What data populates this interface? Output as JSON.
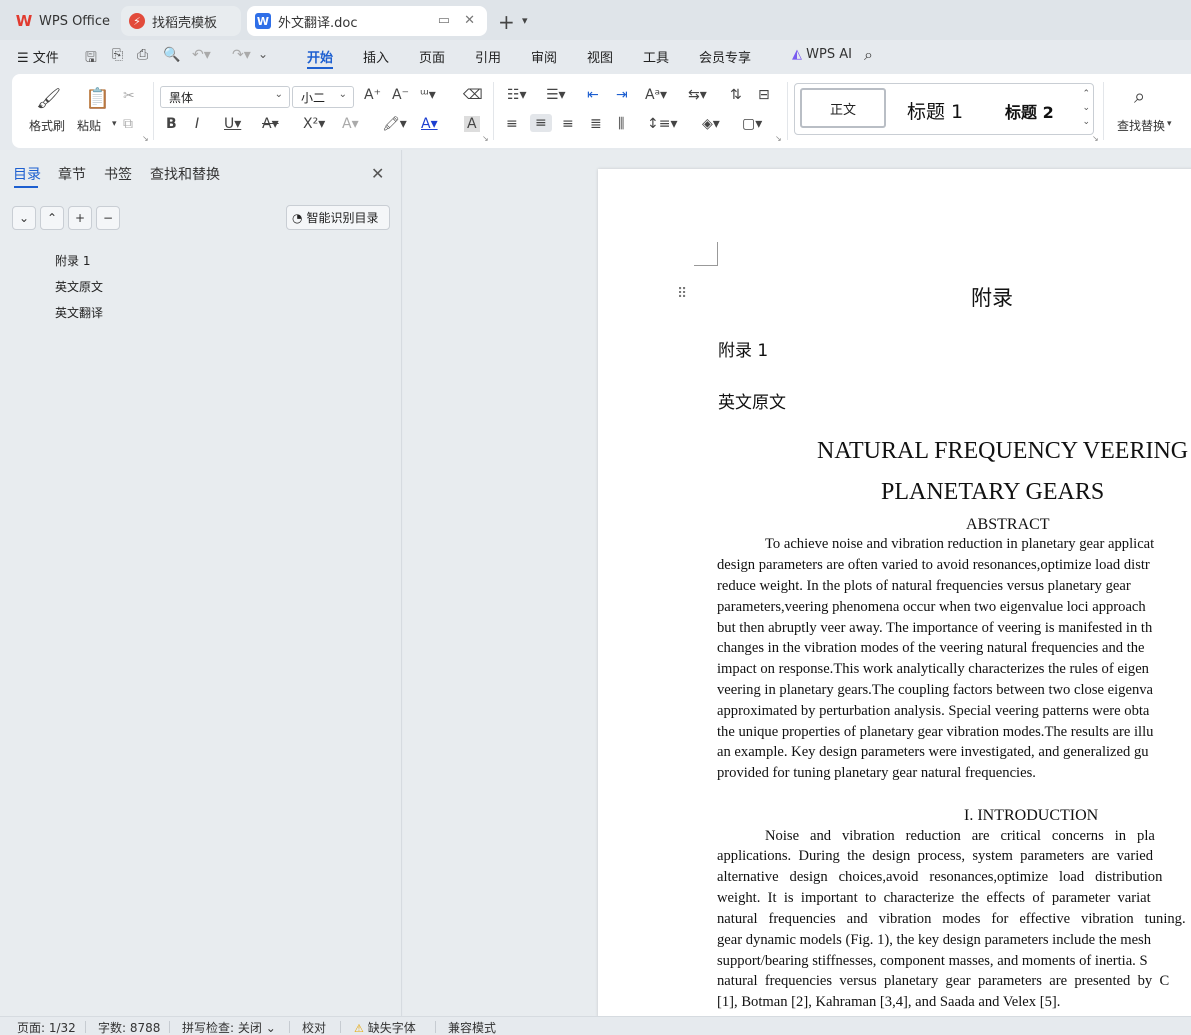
{
  "tabs": {
    "wps_office": "WPS Office",
    "template": "找稻壳模板",
    "document": "外文翻译.doc",
    "new_tab": "+"
  },
  "menu": {
    "file": "文件",
    "tabs": [
      "开始",
      "插入",
      "页面",
      "引用",
      "审阅",
      "视图",
      "工具",
      "会员专享"
    ],
    "wps_ai": "WPS AI"
  },
  "ribbon": {
    "format_painter": "格式刷",
    "paste": "粘贴",
    "font_name": "黑体",
    "font_size": "小二",
    "styles": {
      "normal": "正文",
      "heading1": "标题  1",
      "heading2": "标题  2"
    },
    "find_replace": "查找替换"
  },
  "left_pane": {
    "tabs": [
      "目录",
      "章节",
      "书签",
      "查找和替换"
    ],
    "smart_toc": "智能识别目录",
    "toc_items": [
      "附录 1",
      "英文原文",
      "英文翻译"
    ]
  },
  "document": {
    "appendix": "附录",
    "appendix1": "附录 1",
    "original_text": "英文原文",
    "title_line1": "NATURAL FREQUENCY VEERING",
    "title_line2": "PLANETARY GEARS",
    "abstract_heading": "ABSTRACT",
    "abstract_lines": [
      "To achieve noise and vibration reduction in planetary gear applicat",
      "design parameters are often varied to avoid resonances,optimize load distr",
      "reduce weight. In the plots of natural frequencies versus planetary gear",
      "parameters,veering phenomena occur when two eigenvalue loci approach",
      "but then abruptly veer away. The importance of veering is manifested in th",
      "changes in the vibration modes of the veering natural frequencies and the",
      "impact on response.This work analytically characterizes the rules of eigen",
      "veering in planetary gears.The coupling factors between two close eigenva",
      "approximated by perturbation analysis. Special veering patterns were obta",
      "the unique properties of planetary gear vibration modes.The results are illu",
      "an example. Key design parameters were investigated, and generalized gu",
      "provided for tuning planetary gear natural frequencies."
    ],
    "intro_heading": "I. INTRODUCTION",
    "intro_lines": [
      "Noise   and   vibration   reduction   are   critical   concerns   in   pla",
      "applications.  During  the  design  process,  system  parameters  are  varied",
      "alternative   design   choices,avoid   resonances,optimize   load   distribution",
      "weight.  It  is  important  to  characterize  the  effects  of  parameter  variat",
      "natural   frequencies   and   vibration   modes   for   effective   vibration   tuning.",
      "gear dynamic models (Fig. 1), the key design parameters include the mesh",
      "support/bearing stiffnesses, component masses, and moments of inertia. S",
      "natural  frequencies  versus  planetary  gear  parameters  are  presented  by  C",
      "[1], Botman [2], Kahraman [3,4], and Saada and Velex [5]."
    ]
  },
  "status": {
    "page": "页面: 1/32",
    "word_count": "字数: 8788",
    "spell_check": "拼写检查: 关闭",
    "proofread": "校对",
    "missing_fonts": "缺失字体",
    "compat_mode": "兼容模式"
  }
}
